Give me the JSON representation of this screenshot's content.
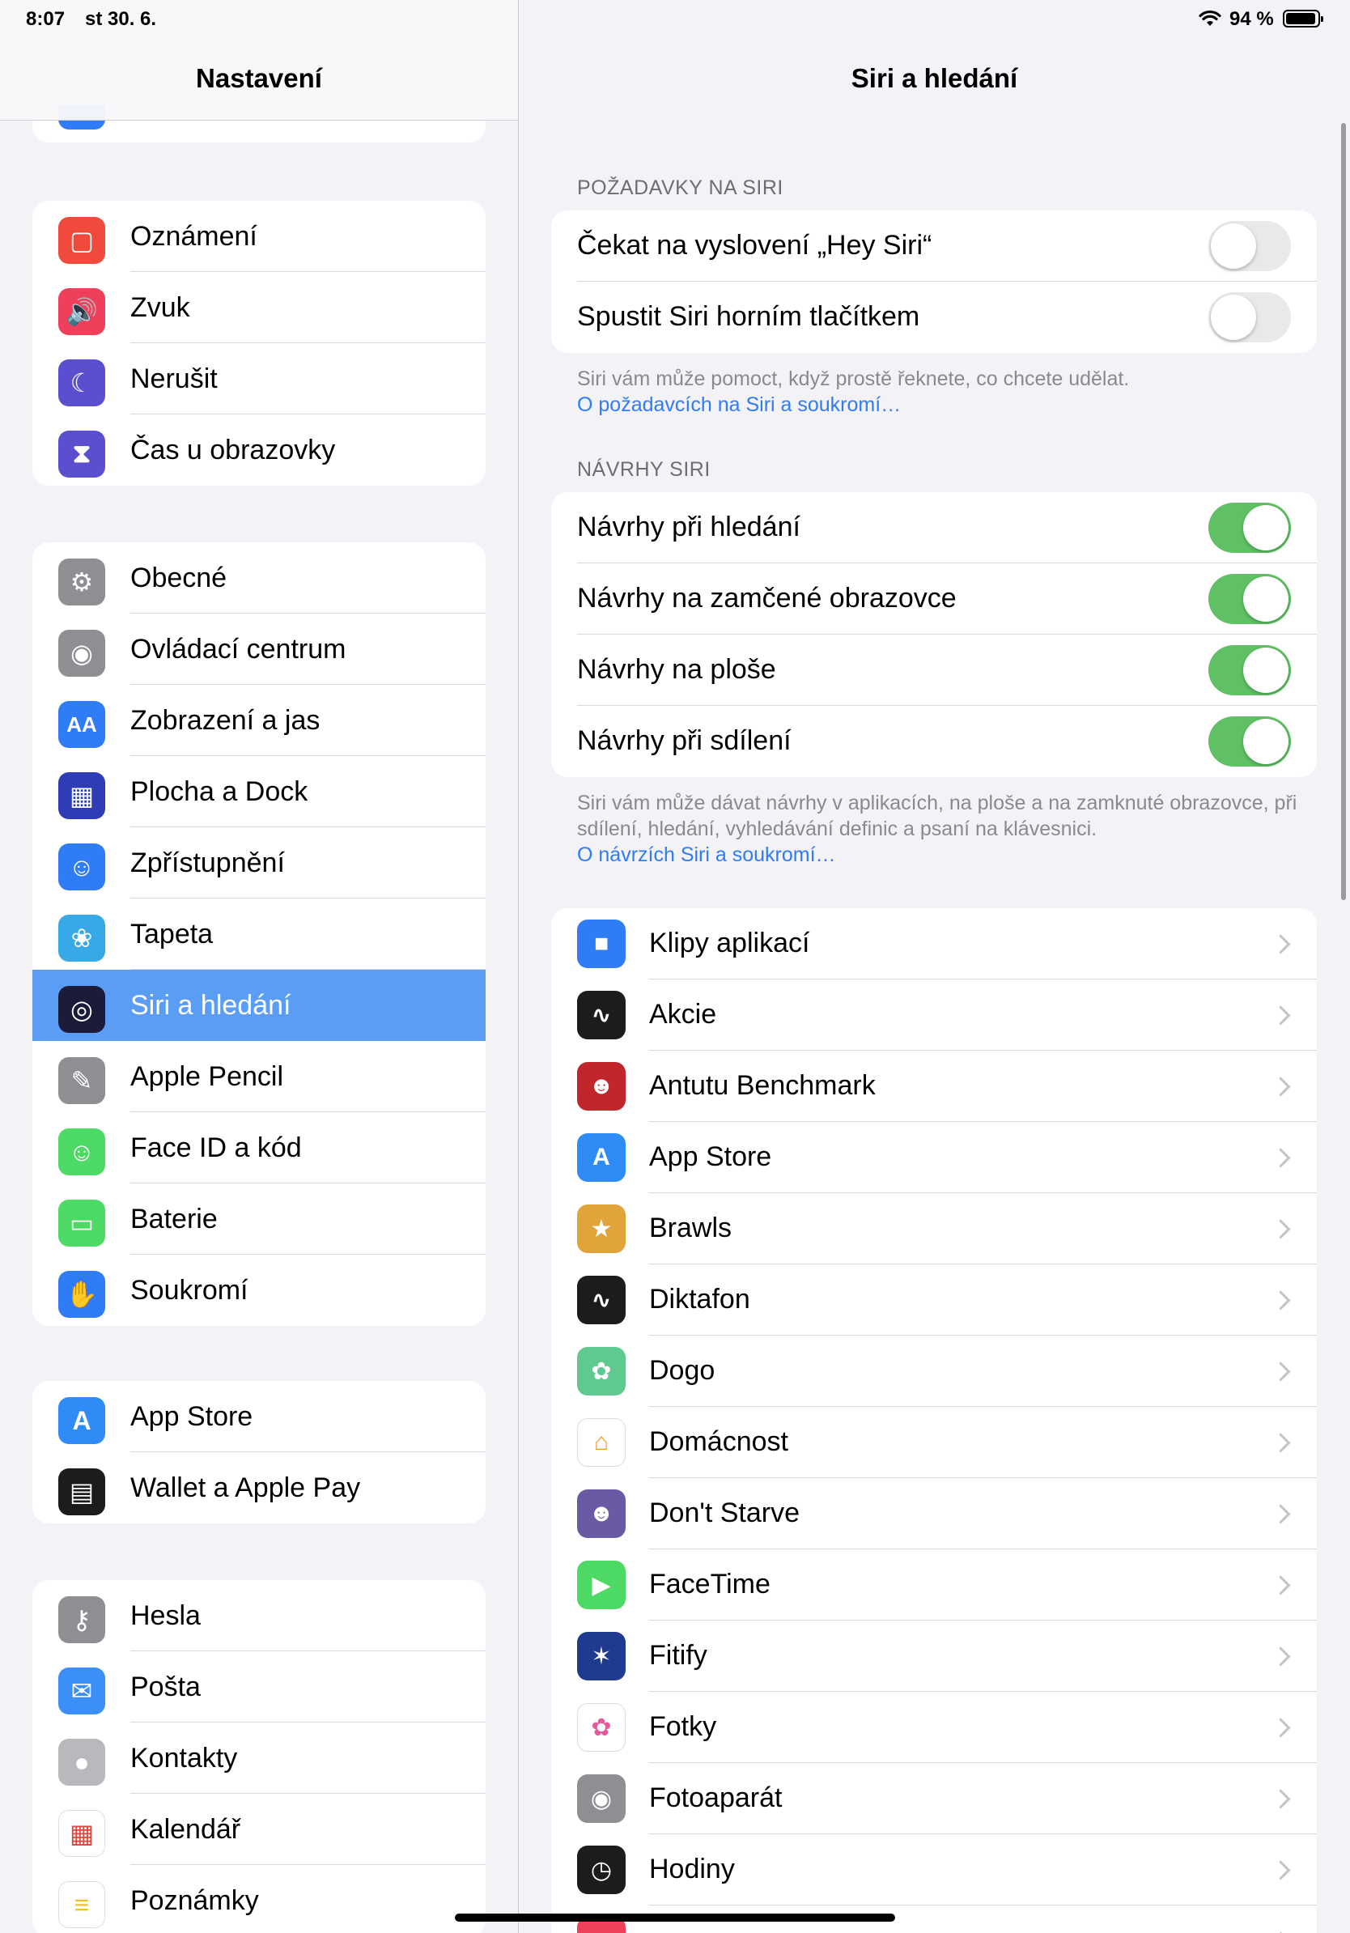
{
  "status": {
    "time": "8:07",
    "date": "st 30. 6.",
    "battery_pct": "94 %"
  },
  "left": {
    "title": "Nastavení",
    "groups": [
      [
        {
          "label": "Oznámení",
          "icon": "notifications-icon",
          "color": "#ef4a3c"
        },
        {
          "label": "Zvuk",
          "icon": "sound-icon",
          "color": "#ef3f5a"
        },
        {
          "label": "Nerušit",
          "icon": "moon-icon",
          "color": "#5a4fcf"
        },
        {
          "label": "Čas u obrazovky",
          "icon": "hourglass-icon",
          "color": "#5a4fcf"
        }
      ],
      [
        {
          "label": "Obecné",
          "icon": "gear-icon",
          "color": "#8e8e93"
        },
        {
          "label": "Ovládací centrum",
          "icon": "control-center-icon",
          "color": "#8e8e93"
        },
        {
          "label": "Zobrazení a jas",
          "icon": "display-icon",
          "color": "#2f7cf6",
          "glyph": "AA"
        },
        {
          "label": "Plocha a Dock",
          "icon": "home-screen-icon",
          "color": "#2e3db5"
        },
        {
          "label": "Zpřístupnění",
          "icon": "accessibility-icon",
          "color": "#2f7cf6"
        },
        {
          "label": "Tapeta",
          "icon": "wallpaper-icon",
          "color": "#37a9e6"
        },
        {
          "label": "Siri a hledání",
          "icon": "siri-icon",
          "color": "#1c1c3a",
          "selected": true
        },
        {
          "label": "Apple Pencil",
          "icon": "pencil-icon",
          "color": "#8e8e93"
        },
        {
          "label": "Face ID a kód",
          "icon": "face-id-icon",
          "color": "#4cd964"
        },
        {
          "label": "Baterie",
          "icon": "battery-icon",
          "color": "#4cd964"
        },
        {
          "label": "Soukromí",
          "icon": "hand-icon",
          "color": "#2f7cf6"
        }
      ],
      [
        {
          "label": "App Store",
          "icon": "app-store-icon",
          "color": "#2f8cf6"
        },
        {
          "label": "Wallet a Apple Pay",
          "icon": "wallet-icon",
          "color": "#1c1c1e"
        }
      ],
      [
        {
          "label": "Hesla",
          "icon": "key-icon",
          "color": "#8e8e93"
        },
        {
          "label": "Pošta",
          "icon": "mail-icon",
          "color": "#3b8ff6"
        },
        {
          "label": "Kontakty",
          "icon": "contacts-icon",
          "color": "#b8b8bd"
        },
        {
          "label": "Kalendář",
          "icon": "calendar-icon",
          "color": "#ffffff"
        },
        {
          "label": "Poznámky",
          "icon": "notes-icon",
          "color": "#ffffff"
        }
      ]
    ]
  },
  "right": {
    "title": "Siri a hledání",
    "section1": {
      "title": "POŽADAVKY NA SIRI",
      "rows": [
        {
          "label": "Čekat na vyslovení „Hey Siri“",
          "on": false
        },
        {
          "label": "Spustit Siri horním tlačítkem",
          "on": false
        }
      ],
      "footnote": "Siri vám může pomoct, když prostě řeknete, co chcete udělat.",
      "link": "O požadavcích na Siri a soukromí…"
    },
    "section2": {
      "title": "NÁVRHY SIRI",
      "rows": [
        {
          "label": "Návrhy při hledání",
          "on": true
        },
        {
          "label": "Návrhy na zamčené obrazovce",
          "on": true
        },
        {
          "label": "Návrhy na ploše",
          "on": true
        },
        {
          "label": "Návrhy při sdílení",
          "on": true
        }
      ],
      "footnote": "Siri vám může dávat návrhy v aplikacích, na ploše a na zamknuté obrazovce, při sdílení, hledání, vyhledávání definic a psaní na klávesnici.",
      "link": "O návrzích Siri a soukromí…"
    },
    "apps": [
      {
        "label": "Klipy aplikací",
        "icon": "app-clips-icon",
        "color": "#2f7cf6"
      },
      {
        "label": "Akcie",
        "icon": "stocks-icon",
        "color": "#1c1c1e"
      },
      {
        "label": "Antutu Benchmark",
        "icon": "antutu-icon",
        "color": "#c0262a"
      },
      {
        "label": "App Store",
        "icon": "app-store-icon",
        "color": "#2f8cf6"
      },
      {
        "label": "Brawls",
        "icon": "brawls-icon",
        "color": "#e0a43a"
      },
      {
        "label": "Diktafon",
        "icon": "voice-memos-icon",
        "color": "#1c1c1e"
      },
      {
        "label": "Dogo",
        "icon": "paw-icon",
        "color": "#5fc98f"
      },
      {
        "label": "Domácnost",
        "icon": "home-icon",
        "color": "#ffffff"
      },
      {
        "label": "Don't Starve",
        "icon": "dont-starve-icon",
        "color": "#6a5aa6"
      },
      {
        "label": "FaceTime",
        "icon": "facetime-icon",
        "color": "#4cd964"
      },
      {
        "label": "Fitify",
        "icon": "fitify-icon",
        "color": "#1f3b8f"
      },
      {
        "label": "Fotky",
        "icon": "photos-icon",
        "color": "#ffffff"
      },
      {
        "label": "Fotoaparát",
        "icon": "camera-icon",
        "color": "#8e8e93"
      },
      {
        "label": "Hodiny",
        "icon": "clock-icon",
        "color": "#1c1c1e"
      },
      {
        "label": "",
        "icon": "music-icon",
        "color": "#f0405a"
      }
    ]
  }
}
